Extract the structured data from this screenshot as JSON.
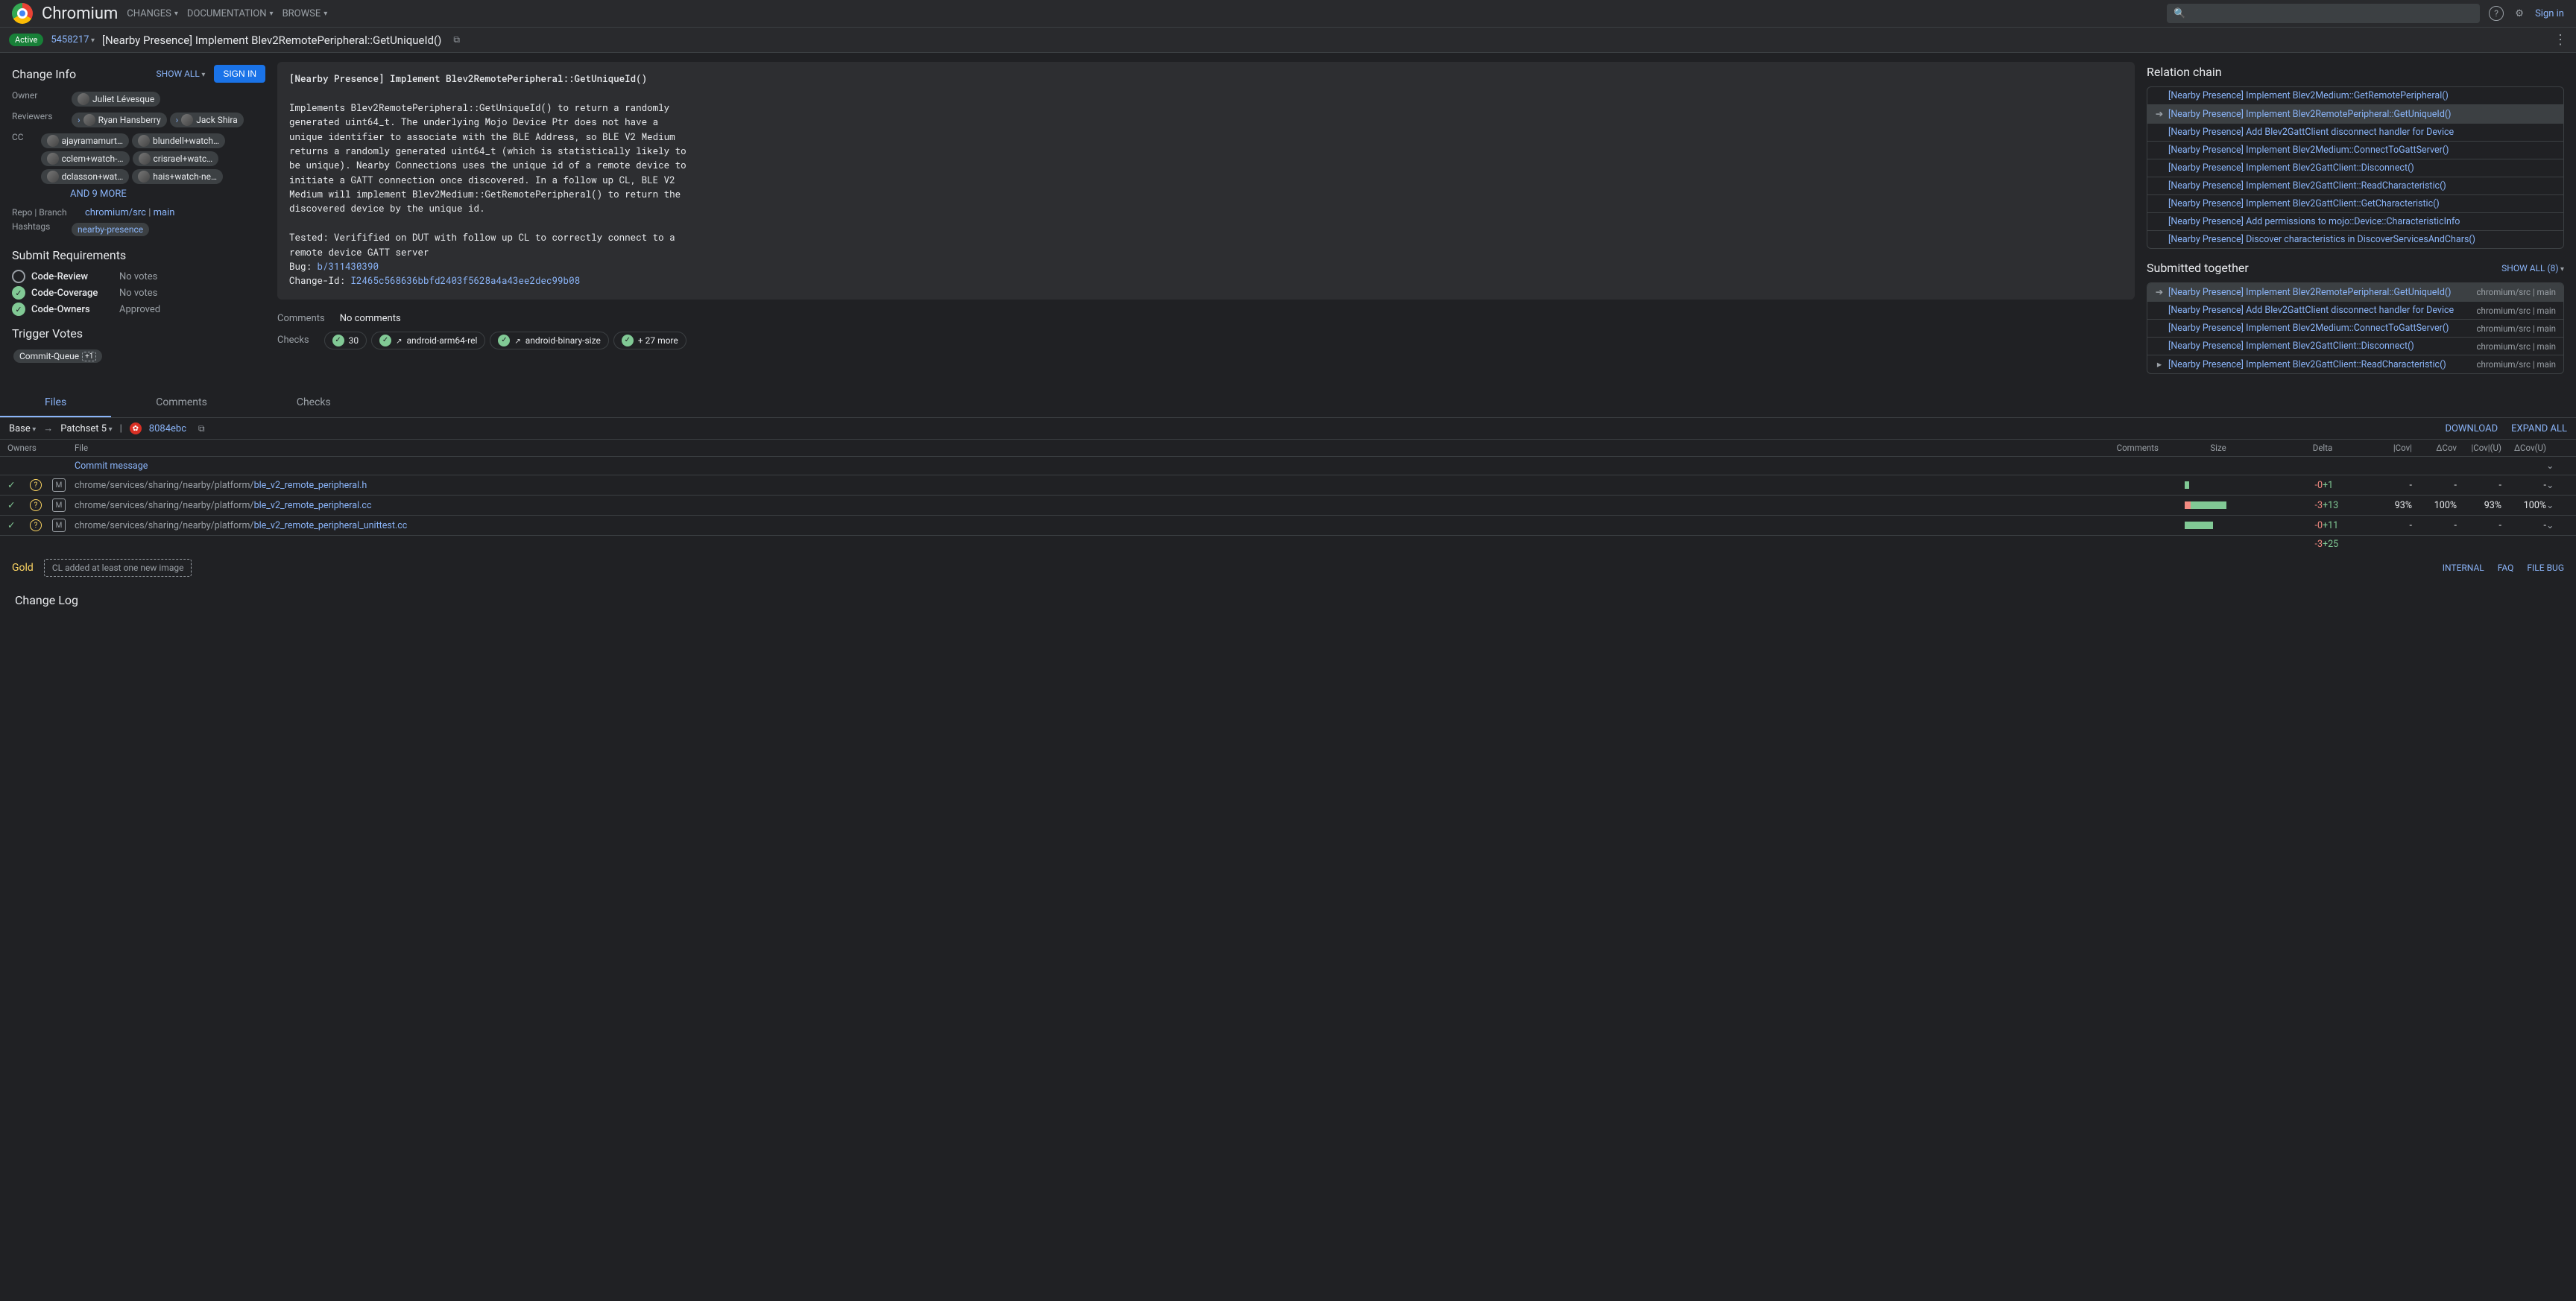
{
  "header": {
    "brand": "Chromium",
    "menu": [
      "CHANGES",
      "DOCUMENTATION",
      "BROWSE"
    ],
    "search_placeholder": "",
    "sign_in": "Sign in"
  },
  "subheader": {
    "status": "Active",
    "change_number": "5458217",
    "title": "[Nearby Presence] Implement Blev2RemotePeripheral::GetUniqueId()"
  },
  "change_info": {
    "heading": "Change Info",
    "show_all": "SHOW ALL",
    "sign_in_btn": "SIGN IN",
    "owner_label": "Owner",
    "owner": "Juliet Lévesque",
    "reviewers_label": "Reviewers",
    "reviewers": [
      "Ryan Hansberry",
      "Jack Shira"
    ],
    "cc_label": "CC",
    "cc": [
      "ajayramamurt…",
      "blundell+watch…",
      "cclem+watch-…",
      "crisrael+watc…",
      "dclasson+wat…",
      "hais+watch-ne…"
    ],
    "and_more": "AND 9 MORE",
    "repo_label": "Repo | Branch",
    "repo": "chromium/src",
    "branch": "main",
    "hashtags_label": "Hashtags",
    "hashtag": "nearby-presence"
  },
  "submit_req": {
    "heading": "Submit Requirements",
    "rows": [
      {
        "icon": "empty",
        "name": "Code-Review",
        "status": "No votes"
      },
      {
        "icon": "ok",
        "name": "Code-Coverage",
        "status": "No votes"
      },
      {
        "icon": "ok",
        "name": "Code-Owners",
        "status": "Approved"
      }
    ]
  },
  "trigger": {
    "heading": "Trigger Votes",
    "chip": "Commit-Queue",
    "chip_badge": "+1"
  },
  "commit_msg": {
    "title_line": "[Nearby Presence] Implement Blev2RemotePeripheral::GetUniqueId()",
    "body": "Implements Blev2RemotePeripheral::GetUniqueId() to return a randomly\ngenerated uint64_t. The underlying Mojo Device Ptr does not have a\nunique identifier to associate with the BLE Address, so BLE V2 Medium\nreturns a randomly generated uint64_t (which is statistically likely to\nbe unique). Nearby Connections uses the unique id of a remote device to\ninitiate a GATT connection once discovered. In a follow up CL, BLE V2\nMedium will implement Blev2Medium::GetRemotePeripheral() to return the\ndiscovered device by the unique id.\n\nTested: Verifified on DUT with follow up CL to correctly connect to a\nremote device GATT server",
    "bug_label": "Bug: ",
    "bug_link": "b/311430390",
    "changeid_label": "Change-Id: ",
    "changeid": "I2465c568636bbfd2403f5628a4a43ee2dec99b08"
  },
  "comments_row": {
    "label": "Comments",
    "value": "No comments"
  },
  "checks_row": {
    "label": "Checks",
    "runs": [
      {
        "count": "30"
      },
      {
        "name": "android-arm64-rel",
        "ext": true
      },
      {
        "name": "android-binary-size",
        "ext": true
      },
      {
        "name": "+ 27 more"
      }
    ]
  },
  "relation": {
    "heading": "Relation chain",
    "items": [
      {
        "t": "[Nearby Presence] Implement Blev2Medium::GetRemotePeripheral()"
      },
      {
        "t": "[Nearby Presence] Implement Blev2RemotePeripheral::GetUniqueId()",
        "sel": true,
        "arrow": true
      },
      {
        "t": "[Nearby Presence] Add Blev2GattClient disconnect handler for Device"
      },
      {
        "t": "[Nearby Presence] Implement Blev2Medium::ConnectToGattServer()"
      },
      {
        "t": "[Nearby Presence] Implement Blev2GattClient::Disconnect()"
      },
      {
        "t": "[Nearby Presence] Implement Blev2GattClient::ReadCharacteristic()"
      },
      {
        "t": "[Nearby Presence] Implement Blev2GattClient::GetCharacteristic()"
      },
      {
        "t": "[Nearby Presence] Add permissions to mojo::Device::CharacteristicInfo"
      },
      {
        "t": "[Nearby Presence] Discover characteristics in DiscoverServicesAndChars()"
      }
    ]
  },
  "submitted": {
    "heading": "Submitted together",
    "show_all": "SHOW ALL (8)",
    "items": [
      {
        "t": "[Nearby Presence] Implement Blev2RemotePeripheral::GetUniqueId()",
        "repo": "chromium/src | main",
        "arrow": true,
        "sel": true
      },
      {
        "t": "[Nearby Presence] Add Blev2GattClient disconnect handler for Device",
        "repo": "chromium/src | main"
      },
      {
        "t": "[Nearby Presence] Implement Blev2Medium::ConnectToGattServer()",
        "repo": "chromium/src | main"
      },
      {
        "t": "[Nearby Presence] Implement Blev2GattClient::Disconnect()",
        "repo": "chromium/src | main"
      },
      {
        "t": "[Nearby Presence] Implement Blev2GattClient::ReadCharacteristic()",
        "repo": "chromium/src | main",
        "expand": true
      }
    ]
  },
  "tabs": {
    "items": [
      "Files",
      "Comments",
      "Checks"
    ],
    "active": 0
  },
  "filebar": {
    "base": "Base",
    "patchset": "Patchset 5",
    "patch_color": "#d93025",
    "sha": "8084ebc",
    "download": "DOWNLOAD",
    "expand": "EXPAND ALL"
  },
  "file_table": {
    "headers": [
      "Owners",
      "File",
      "Comments",
      "Size",
      "Delta",
      "|Cov|",
      "ΔCov",
      "|Cov|(U)",
      "ΔCov(U)"
    ],
    "commit_row": "Commit message",
    "rows": [
      {
        "path_pre": "chrome/services/sharing/nearby/platform/",
        "path_file": "ble_v2_remote_peripheral.h",
        "del": 0,
        "add": 1,
        "delw": 0,
        "addw": 6,
        "d_del": "-0",
        "d_add": "+1",
        "cov": "-",
        "dcov": "-",
        "covu": "-",
        "dcovu": "-"
      },
      {
        "path_pre": "chrome/services/sharing/nearby/platform/",
        "path_file": "ble_v2_remote_peripheral.cc",
        "del": 3,
        "add": 13,
        "delw": 8,
        "addw": 48,
        "d_del": "-3",
        "d_add": "+13",
        "cov": "93%",
        "dcov": "100%",
        "covu": "93%",
        "dcovu": "100%"
      },
      {
        "path_pre": "chrome/services/sharing/nearby/platform/",
        "path_file": "ble_v2_remote_peripheral_unittest.cc",
        "del": 0,
        "add": 11,
        "delw": 0,
        "addw": 38,
        "d_del": "-0",
        "d_add": "+11",
        "cov": "-",
        "dcov": "-",
        "covu": "-",
        "dcovu": "-"
      }
    ],
    "total": {
      "d_del": "-3",
      "d_add": "+25"
    }
  },
  "footer": {
    "gold": "Gold",
    "note": "CL added at least one new image",
    "links": [
      "INTERNAL",
      "FAQ",
      "FILE BUG"
    ]
  },
  "change_log": "Change Log"
}
